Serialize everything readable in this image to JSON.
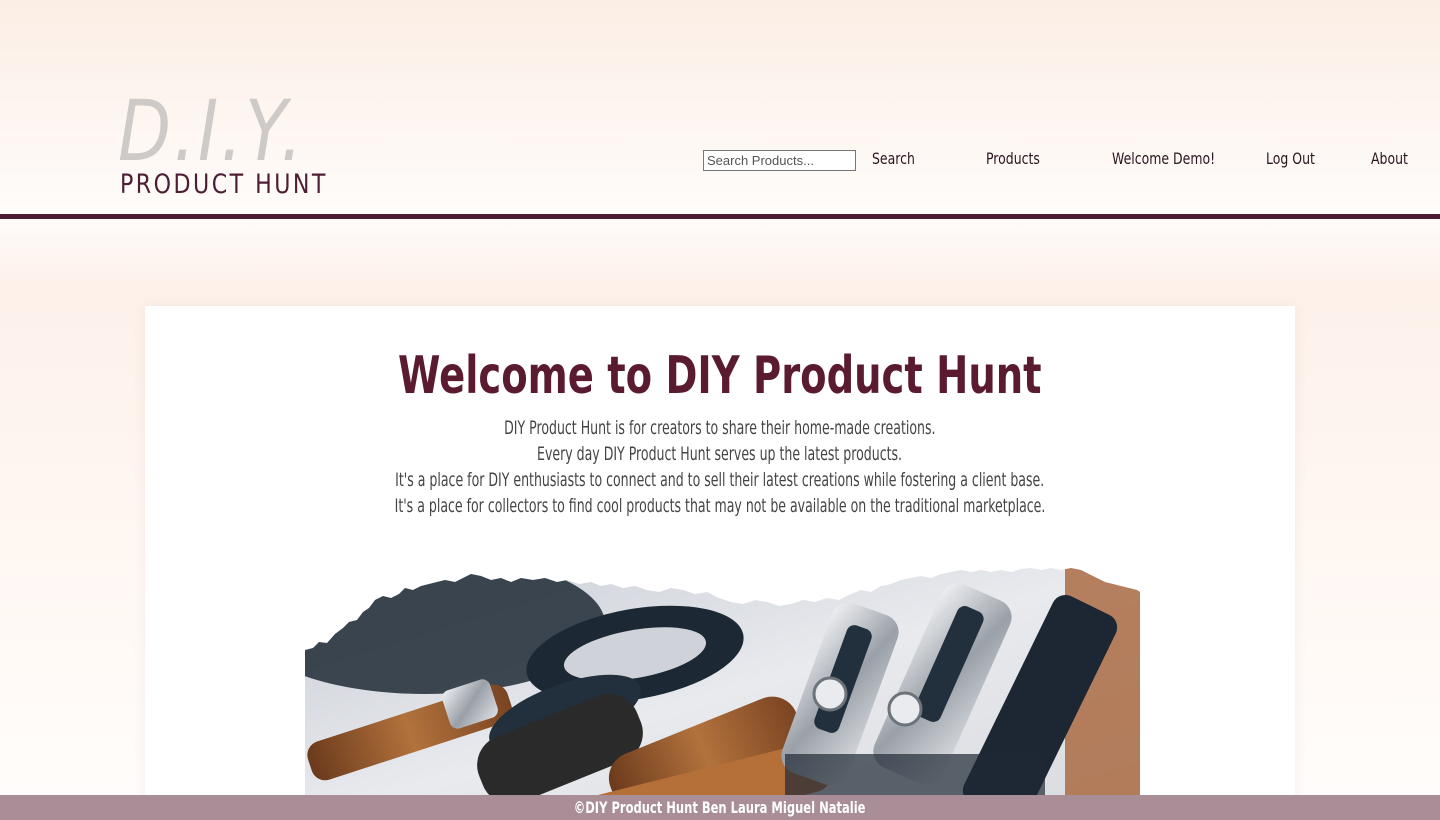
{
  "brand": {
    "logo_main": "D.I.Y.",
    "logo_sub": "PRODUCT HUNT"
  },
  "nav": {
    "search_placeholder": "Search Products...",
    "search_label": "Search",
    "products_label": "Products",
    "welcome_label": "Welcome Demo!",
    "logout_label": "Log Out",
    "about_label": "About"
  },
  "main": {
    "title": "Welcome to DIY Product Hunt",
    "intro_lines": [
      "DIY Product Hunt is for creators to share their home-made creations.",
      "Every day DIY Product Hunt serves up the latest products.",
      "It's a place for DIY enthusiasts to connect and to sell their latest creations while fostering a client base.",
      "It's a place for collectors to find cool products that may not be available on the traditional marketplace."
    ]
  },
  "footer": {
    "text": "©DIY Product Hunt Ben Laura Miguel Natalie"
  },
  "colors": {
    "brand_dark": "#4d1d33",
    "title": "#5a1a2f",
    "logo_light": "#cdcac8",
    "footer_bg": "#a98e98"
  }
}
